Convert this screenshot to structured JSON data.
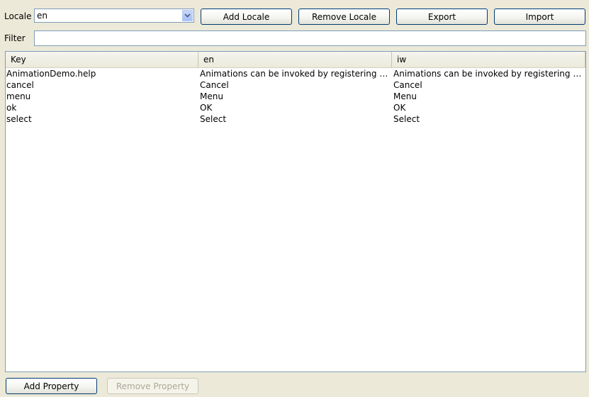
{
  "toolbar": {
    "locale_label": "Locale",
    "locale_value": "en",
    "add_locale": "Add Locale",
    "remove_locale": "Remove Locale",
    "export": "Export",
    "import": "Import"
  },
  "filter": {
    "label": "Filter",
    "value": ""
  },
  "table": {
    "columns": [
      "Key",
      "en",
      "iw"
    ],
    "rows": [
      [
        "AnimationDemo.help",
        "Animations can be invoked by registering the...",
        "Animations can be invoked by registering the..."
      ],
      [
        "cancel",
        "Cancel",
        "Cancel"
      ],
      [
        "menu",
        "Menu",
        "Menu"
      ],
      [
        "ok",
        "OK",
        "OK"
      ],
      [
        "select",
        "Select",
        "Select"
      ]
    ]
  },
  "footer": {
    "add_property": "Add Property",
    "remove_property": "Remove Property"
  },
  "colors": {
    "background": "#ece9d8",
    "border": "#7f9db9",
    "button_border": "#003c74",
    "disabled_text": "#aca899"
  },
  "icons": {
    "combo_arrow": "chevron-down-icon"
  }
}
